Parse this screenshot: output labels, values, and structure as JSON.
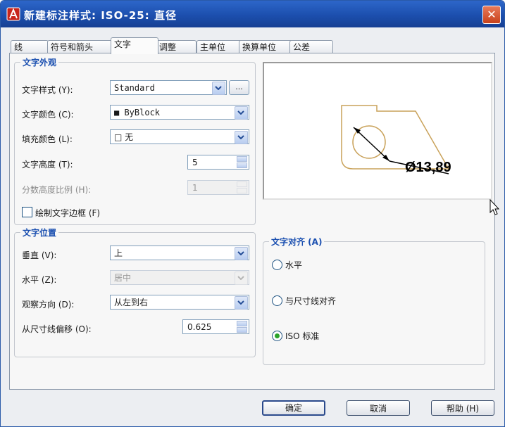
{
  "window": {
    "title": "新建标注样式: ISO-25: 直径",
    "close_glyph": "✕",
    "accent": "#1c4fae",
    "app_icon": "autocad-icon"
  },
  "tabs": [
    {
      "label": "线",
      "active": false
    },
    {
      "label": "符号和箭头",
      "active": false
    },
    {
      "label": "文字",
      "active": true
    },
    {
      "label": "调整",
      "active": false
    },
    {
      "label": "主单位",
      "active": false
    },
    {
      "label": "换算单位",
      "active": false
    },
    {
      "label": "公差",
      "active": false
    }
  ],
  "text_appearance": {
    "title": "文字外观",
    "style_label": "文字样式 (Y):",
    "style_value": "Standard",
    "style_browse": "...",
    "color_label": "文字颜色 (C):",
    "color_value": "■ ByBlock",
    "fill_label": "填充颜色 (L):",
    "fill_value": "□ 无",
    "height_label": "文字高度 (T):",
    "height_value": "5",
    "fraction_label": "分数高度比例 (H):",
    "fraction_value": "1",
    "frame_label": "绘制文字边框 (F)",
    "frame_checked": false
  },
  "preview": {
    "dimension_text": "Ø13,89",
    "outline_color": "#c9a25a"
  },
  "text_placement": {
    "title": "文字位置",
    "vertical_label": "垂直 (V):",
    "vertical_value": "上",
    "horizontal_label": "水平 (Z):",
    "horizontal_value": "居中",
    "view_dir_label": "观察方向 (D):",
    "view_dir_value": "从左到右",
    "offset_label": "从尺寸线偏移 (O):",
    "offset_value": "0.625"
  },
  "text_alignment": {
    "title": "文字对齐 (A)",
    "options": [
      {
        "label": "水平",
        "selected": false
      },
      {
        "label": "与尺寸线对齐",
        "selected": false
      },
      {
        "label": "ISO 标准",
        "selected": true
      }
    ]
  },
  "buttons": {
    "ok": "确定",
    "cancel": "取消",
    "help": "帮助 (H)"
  }
}
